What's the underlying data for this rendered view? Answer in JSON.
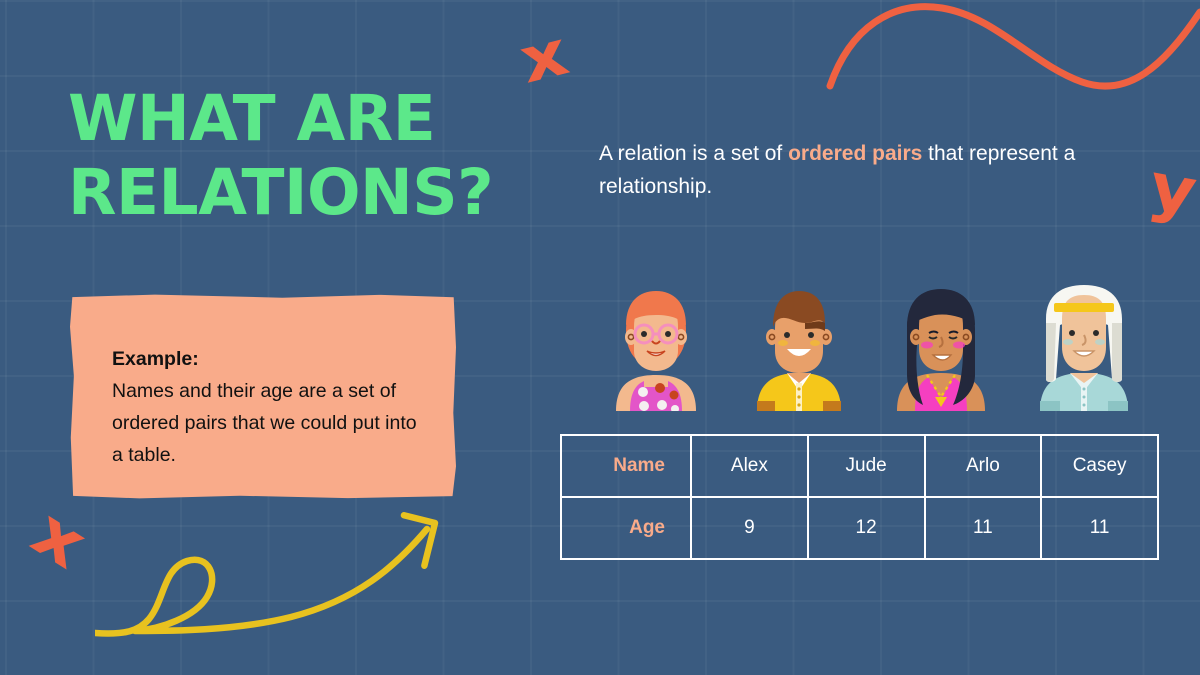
{
  "slide": {
    "title": "WHAT ARE\nRELATIONS?",
    "background_color": "#3a5b80",
    "accent_green": "#5ce88a",
    "accent_salmon": "#f9ab8a",
    "accent_red": "#ef6141",
    "accent_yellow": "#e8c21f"
  },
  "lead": {
    "part1": "A relation is a set of ",
    "highlight": "ordered pairs",
    "part2": " that represent a relationship."
  },
  "example_card": {
    "label": "Example:",
    "body": "Names and their age are a set of ordered pairs that we could put into a table."
  },
  "decorations": {
    "x_top": "x",
    "y_right": "y",
    "x_bottom": "x"
  },
  "people": [
    {
      "name": "person-girl-glasses",
      "skin": "#f3b98e",
      "hair": "#f0784c",
      "hair_dark": "#e0643c",
      "top": "#e355c8",
      "top_alt": "#c23fa8",
      "dots": "#f4f0f0",
      "dots_alt": "#c8441f",
      "glasses": "#f58fbd"
    },
    {
      "name": "person-boy-yellow",
      "skin": "#e8a06a",
      "hair": "#8a4a22",
      "hair_dark": "#6f3a19",
      "top": "#f5c71a",
      "top_alt": "#d9a813",
      "collar": "#ffffff",
      "cuff": "#c47a1c"
    },
    {
      "name": "person-girl-longhair",
      "skin": "#d99159",
      "hair": "#23283c",
      "hair_dark": "#171b2a",
      "top": "#f53fc0",
      "top_alt": "#d62ba4",
      "necklace": "#f5c71a"
    },
    {
      "name": "person-keffiyeh",
      "skin": "#f0c39a",
      "headscarf": "#f7f7f2",
      "headscarf_shade": "#dcdcd2",
      "band": "#f5c71a",
      "top": "#a8d8d8",
      "top_alt": "#8cc4c4",
      "collar": "#e8f4f4"
    }
  ],
  "table": {
    "rows": [
      {
        "header": "Name",
        "cells": [
          "Alex",
          "Jude",
          "Arlo",
          "Casey"
        ]
      },
      {
        "header": "Age",
        "cells": [
          "9",
          "12",
          "11",
          "11"
        ]
      }
    ]
  }
}
